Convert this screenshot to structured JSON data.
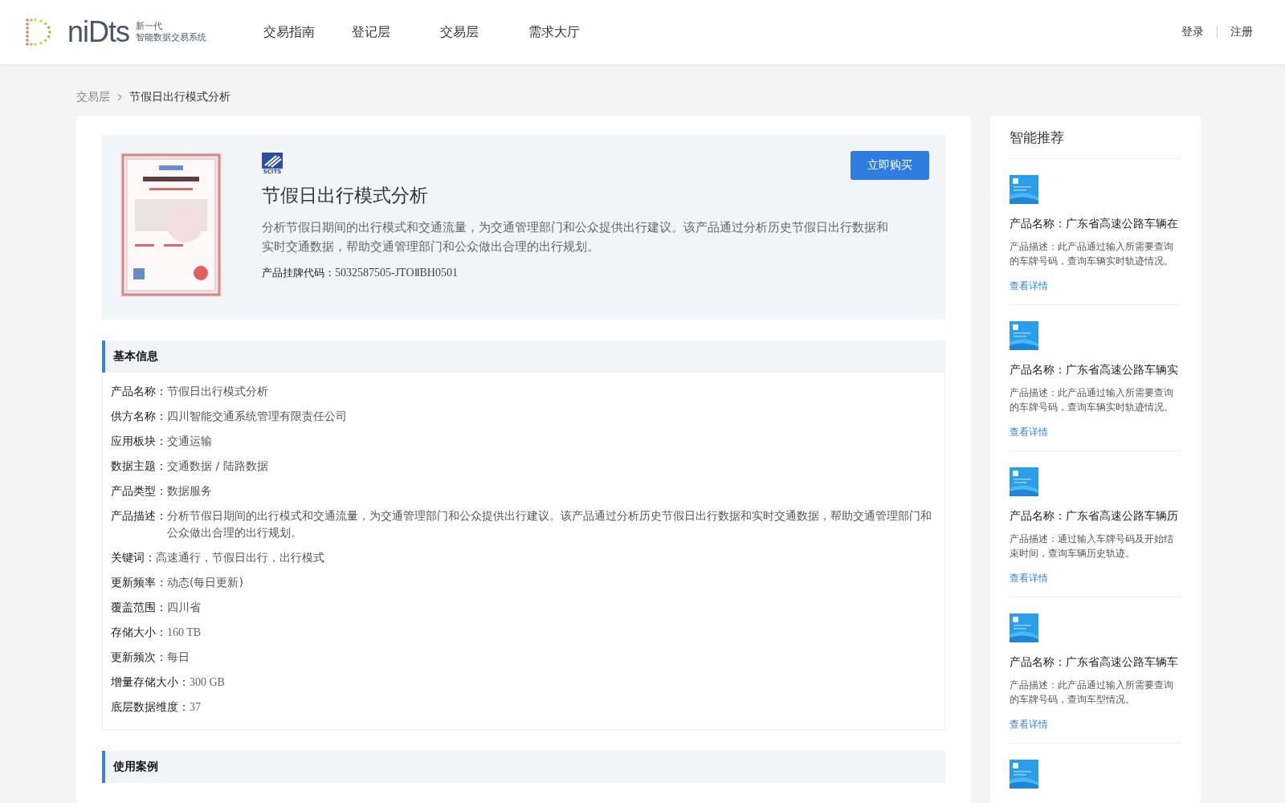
{
  "header": {
    "logo": {
      "wordmark": "niDts",
      "line1": "新一代",
      "line2": "智能数据交易系统"
    },
    "nav": [
      {
        "label": "交易指南",
        "selected": false
      },
      {
        "label": "登记层",
        "selected": false
      },
      {
        "label": "交易层",
        "selected": false
      },
      {
        "label": "需求大厅",
        "selected": false
      }
    ],
    "login": "登录",
    "register": "注册"
  },
  "breadcrumb": [
    {
      "label": "交易层"
    },
    {
      "label": "节假日出行模式分析"
    }
  ],
  "product": {
    "certificate": {
      "kind": "picture"
    },
    "publisher_logo": "SCITS",
    "title": "节假日出行模式分析",
    "description": "分析节假日期间的出行模式和交通流量，为交通管理部门和公众提供出行建议。该产品通过分析历史节假日出行数据和实时交通数据，帮助交通管理部门和公众做出合理的出行规划。",
    "code_label": "产品挂牌代码：",
    "code": "5032587505-JTOⅡBH0501",
    "buy_button": "立即购买"
  },
  "sections": [
    {
      "title": "基本信息",
      "rows": [
        {
          "label": "产品名称：",
          "value": "节假日出行模式分析",
          "kind": "text"
        },
        {
          "label": "供方名称：",
          "value": "四川智能交通系统管理有限责任公司",
          "kind": "text"
        },
        {
          "label": "应用板块：",
          "value": "交通运输",
          "kind": "text"
        },
        {
          "label": "数据主题：",
          "value": "交通数据 / 陆路数据",
          "kind": "text"
        },
        {
          "label": "产品类型：",
          "value": "数据服务",
          "kind": "text"
        },
        {
          "label": "产品描述：",
          "value": "分析节假日期间的出行模式和交通流量，为交通管理部门和公众提供出行建议。该产品通过分析历史节假日出行数据和实时交通数据，帮助交通管理部门和公众做出合理的出行规划。",
          "kind": "text"
        },
        {
          "label": "关键词：",
          "value": "高速通行，节假日出行，出行模式",
          "kind": "text"
        },
        {
          "label": "更新频率：",
          "value": "动态(每日更新)",
          "kind": "text"
        },
        {
          "label": "覆盖范围：",
          "value": "四川省",
          "kind": "text"
        },
        {
          "label": "存储大小：",
          "value": "160 TB",
          "kind": "number"
        },
        {
          "label": "更新频次：",
          "value": "每日",
          "kind": "text"
        },
        {
          "label": "增量存储大小：",
          "value": "300 GB",
          "kind": "number"
        },
        {
          "label": "底层数据维度：",
          "value": "37",
          "kind": "number"
        }
      ]
    },
    {
      "title": "使用案例"
    }
  ],
  "recommend": {
    "title": "智能推荐",
    "items": [
      {
        "name": "产品名称：广东省高速公路车辆在",
        "description": "产品描述：此产品通过输入所需要查询的车牌号码，查询车辆实时轨迹情况。",
        "link": "查看详情"
      },
      {
        "name": "产品名称：广东省高速公路车辆实",
        "description": "产品描述：此产品通过输入所需要查询的车牌号码，查询车辆实时轨迹情况。",
        "link": "查看详情"
      },
      {
        "name": "产品名称：广东省高速公路车辆历",
        "description": "产品描述：通过输入车牌号码及开始结束时间，查询车辆历史轨迹。",
        "link": "查看详情"
      },
      {
        "name": "产品名称：广东省高速公路车辆车",
        "description": "产品描述：此产品通过输入所需要查询的车牌号码，查询车型情况。",
        "link": "查看详情"
      },
      {
        "kind": "picture"
      }
    ]
  }
}
